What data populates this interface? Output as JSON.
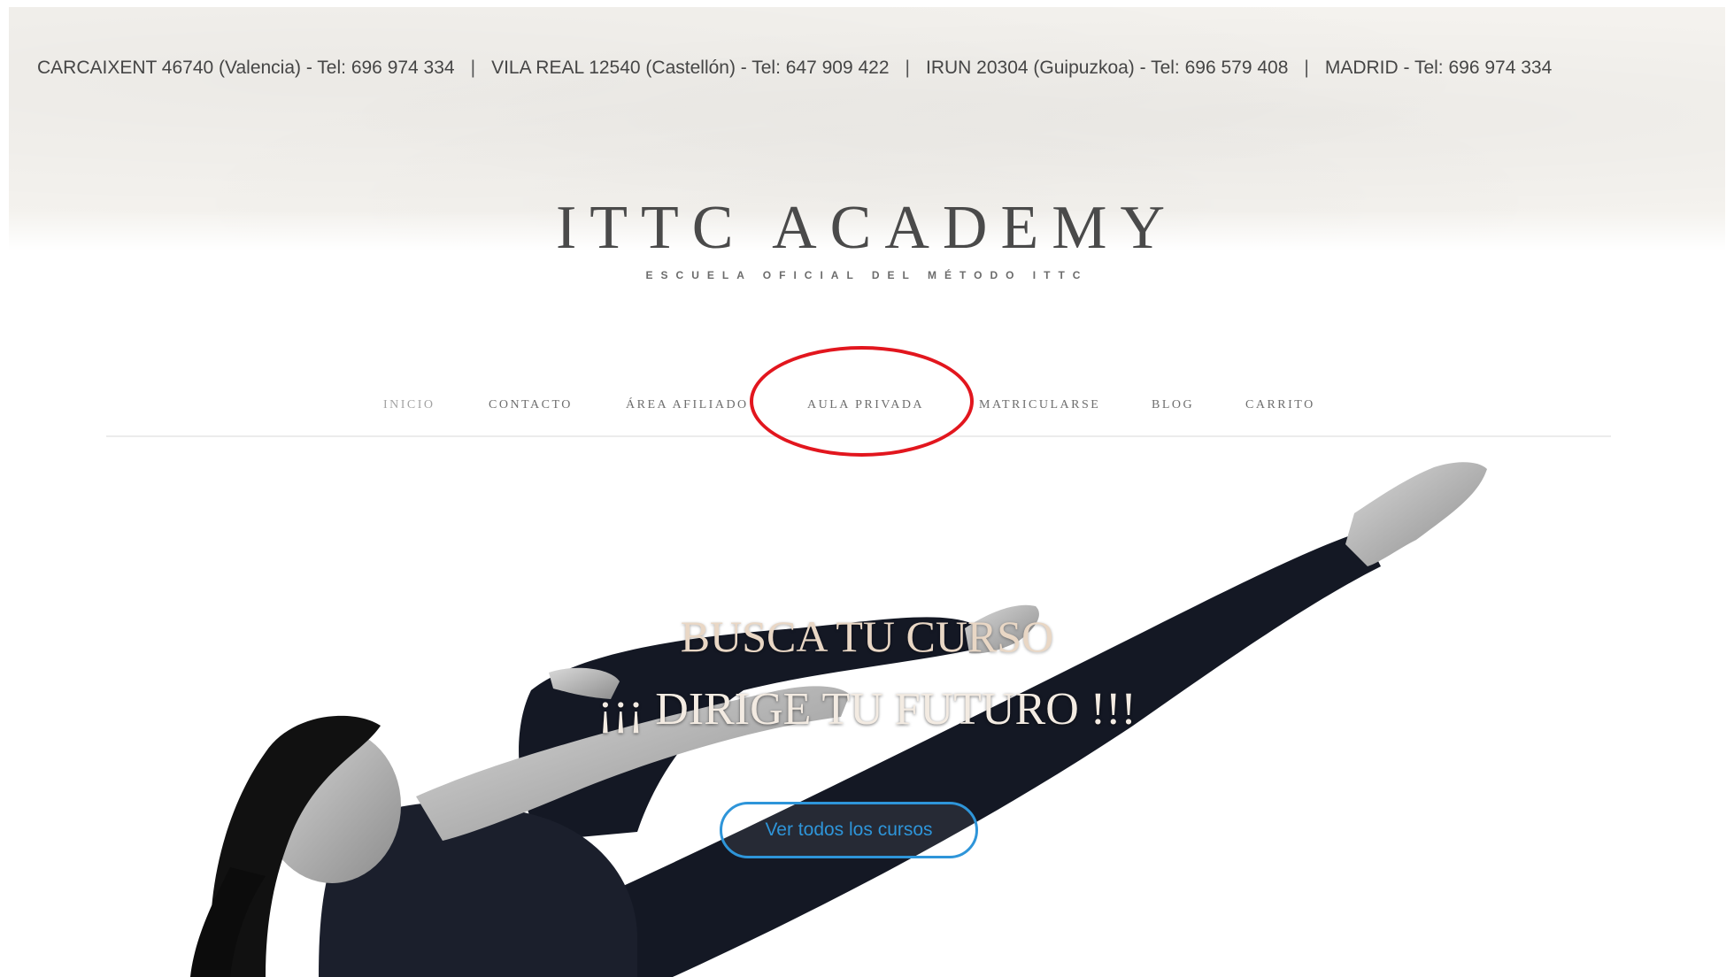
{
  "topbar": {
    "locations": [
      "CARCAIXENT 46740 (Valencia) - Tel: 696 974 334",
      "VILA REAL 12540 (Castellón) - Tel: 647 909 422",
      "IRUN 20304 (Guipuzkoa) - Tel: 696 579 408",
      "MADRID - Tel: 696 974 334"
    ],
    "separator": "|"
  },
  "brand": {
    "name": "ITTC ACADEMY",
    "tagline": "ESCUELA OFICIAL DEL MÉTODO ITTC"
  },
  "nav": {
    "items": [
      {
        "label": "INICIO",
        "active": true
      },
      {
        "label": "CONTACTO"
      },
      {
        "label": "ÁREA AFILIADO"
      },
      {
        "label": "AULA PRIVADA",
        "highlighted": true
      },
      {
        "label": "MATRICULARSE"
      },
      {
        "label": "BLOG"
      },
      {
        "label": "CARRITO"
      }
    ]
  },
  "annotation": {
    "color": "#e2161e",
    "target": "AULA PRIVADA"
  },
  "hero": {
    "title": "BUSCA TU CURSO",
    "subtitle": "¡¡¡ DIRIGE TU FUTURO !!!",
    "cta_label": "Ver todos los cursos",
    "image_subject": "woman-pilates-pose"
  },
  "colors": {
    "cta": "#2e95d9",
    "title": "#e9d7c5",
    "nav_text": "#6e6e6e",
    "annotation": "#e2161e"
  }
}
